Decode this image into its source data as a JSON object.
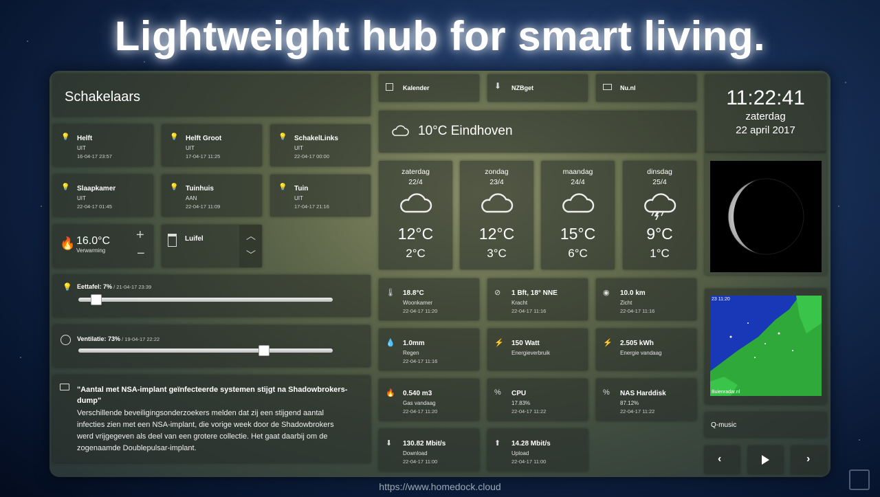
{
  "headline": "Lightweight hub for smart living.",
  "switches": {
    "title": "Schakelaars",
    "items": [
      {
        "name": "Helft",
        "state": "UIT",
        "time": "16-04-17 23:57"
      },
      {
        "name": "Helft Groot",
        "state": "UIT",
        "time": "17-04-17 11:25"
      },
      {
        "name": "SchakelLinks",
        "state": "UIT",
        "time": "22-04-17 00:00"
      },
      {
        "name": "Slaapkamer",
        "state": "UIT",
        "time": "22-04-17 01:45"
      },
      {
        "name": "Tuinhuis",
        "state": "AAN",
        "time": "22-04-17 11:09"
      },
      {
        "name": "Tuin",
        "state": "UIT",
        "time": "17-04-17 21:16"
      }
    ]
  },
  "heating": {
    "value": "16.0°C",
    "label": "Verwarming",
    "plus": "+",
    "minus": "−"
  },
  "blinds": {
    "label": "Luifel"
  },
  "dimmer": {
    "label": "Eettafel: 7%",
    "time": " / 21-04-17 23:39",
    "level_pct": 7
  },
  "fan": {
    "label": "Ventilatie: 73%",
    "time": " / 19-04-17 22:22",
    "level_pct": 73
  },
  "news": {
    "title": "\"Aantal met NSA-implant geïnfecteerde systemen stijgt na Shadowbrokers-dump\"",
    "body": "Verschillende beveiligingsonderzoekers melden dat zij een stijgend aantal infecties zien met een NSA-implant, die vorige week door de Shadowbrokers werd vrijgegeven als deel van een grotere collectie. Het gaat daarbij om de zogenaamde Doublepulsar-implant."
  },
  "links": [
    {
      "label": "Kalender"
    },
    {
      "label": "NZBget"
    },
    {
      "label": "Nu.nl"
    }
  ],
  "weather": {
    "current": "10°C  Eindhoven",
    "forecast": [
      {
        "day": "zaterdag",
        "date": "22/4",
        "high": "12°C",
        "low": "2°C",
        "icon": "cloud"
      },
      {
        "day": "zondag",
        "date": "23/4",
        "high": "12°C",
        "low": "3°C",
        "icon": "cloud"
      },
      {
        "day": "maandag",
        "date": "24/4",
        "high": "15°C",
        "low": "6°C",
        "icon": "cloud"
      },
      {
        "day": "dinsdag",
        "date": "25/4",
        "high": "9°C",
        "low": "1°C",
        "icon": "cloud-rain"
      }
    ]
  },
  "sensors": [
    {
      "value": "18.8°C",
      "label": "Woonkamer",
      "time": "22-04-17 11:20",
      "icon": "thermometer-icon",
      "glyph": "🌡"
    },
    {
      "value": "1 Bft, 18° NNE",
      "label": "Kracht",
      "time": "22-04-17 11:16",
      "icon": "compass-icon",
      "glyph": "⊘"
    },
    {
      "value": "10.0 km",
      "label": "Zicht",
      "time": "22-04-17 11:16",
      "icon": "eye-icon",
      "glyph": "◉"
    },
    {
      "value": "1.0mm",
      "label": "Regen",
      "time": "22-04-17 11:16",
      "icon": "raindrop-icon",
      "glyph": "💧"
    },
    {
      "value": "150 Watt",
      "label": "Energieverbruik",
      "time": "",
      "icon": "plug-icon",
      "glyph": "⚡"
    },
    {
      "value": "2.505 kWh",
      "label": "Energie vandaag",
      "time": "",
      "icon": "plug-icon",
      "glyph": "⚡"
    },
    {
      "value": "0.540 m3",
      "label": "Gas vandaag",
      "time": "22-04-17 11:20",
      "icon": "fire-icon",
      "glyph": "🔥"
    },
    {
      "value": "CPU",
      "label": "17.83%",
      "time": "22-04-17 11:22",
      "icon": "percent-icon",
      "glyph": "%"
    },
    {
      "value": "NAS Harddisk",
      "label": "87.12%",
      "time": "22-04-17 11:22",
      "icon": "percent-icon",
      "glyph": "%"
    },
    {
      "value": "130.82 Mbit/s",
      "label": "Download",
      "time": "22-04-17 11:00",
      "icon": "download-icon",
      "glyph": "⬇"
    },
    {
      "value": "14.28 Mbit/s",
      "label": "Upload",
      "time": "22-04-17 11:00",
      "icon": "upload-icon",
      "glyph": "⬆"
    }
  ],
  "clock": {
    "time": "11:22:41",
    "day": "zaterdag",
    "date": "22 april 2017"
  },
  "radar": {
    "time": "23 11:20",
    "credit": "Buienradar.nl"
  },
  "music": {
    "station": "Q-music"
  },
  "footer": "https://www.homedock.cloud",
  "colors": {
    "accent": "#ffffff",
    "tile": "#2a312c"
  }
}
